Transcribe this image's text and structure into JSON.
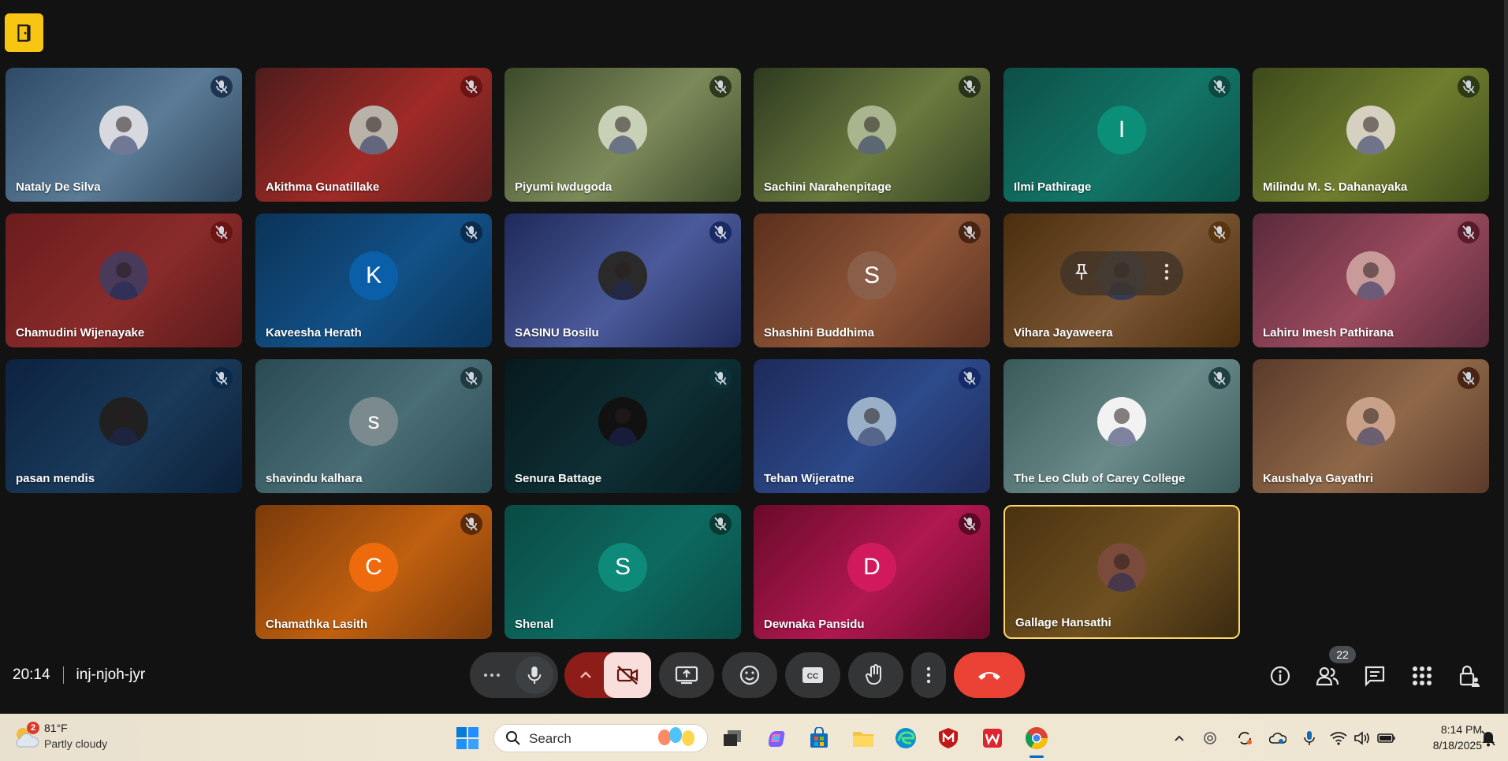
{
  "meeting": {
    "time": "20:14",
    "code": "inj-njoh-jyr",
    "participant_count": "22"
  },
  "colors": {
    "active_border": "#fdd663",
    "end_call": "#ea4335",
    "camera_off": "#f9dedc",
    "logo": "#f9c513"
  },
  "participants": [
    {
      "name": "Nataly De Silva",
      "muted": true,
      "avatar": "photo"
    },
    {
      "name": "Akithma Gunatillake",
      "muted": true,
      "avatar": "photo"
    },
    {
      "name": "Piyumi Iwdugoda",
      "muted": true,
      "avatar": "photo"
    },
    {
      "name": "Sachini Narahenpitage",
      "muted": true,
      "avatar": "photo"
    },
    {
      "name": "Ilmi Pathirage",
      "muted": true,
      "avatar": "letter",
      "letter": "I"
    },
    {
      "name": "Milindu M. S. Dahanayaka",
      "muted": true,
      "avatar": "photo"
    },
    {
      "name": "Chamudini Wijenayake",
      "muted": true,
      "avatar": "photo"
    },
    {
      "name": "Kaveesha Herath",
      "muted": true,
      "avatar": "letter",
      "letter": "K"
    },
    {
      "name": "SASINU Bosilu",
      "muted": true,
      "avatar": "photo"
    },
    {
      "name": "Shashini Buddhima",
      "muted": true,
      "avatar": "letter",
      "letter": "S"
    },
    {
      "name": "Vihara Jayaweera",
      "muted": true,
      "avatar": "photo"
    },
    {
      "name": "Lahiru Imesh Pathirana",
      "muted": true,
      "avatar": "photo"
    },
    {
      "name": "pasan mendis",
      "muted": true,
      "avatar": "photo"
    },
    {
      "name": "shavindu kalhara",
      "muted": true,
      "avatar": "letter",
      "letter": "s"
    },
    {
      "name": "Senura Battage",
      "muted": true,
      "avatar": "photo"
    },
    {
      "name": "Tehan Wijeratne",
      "muted": true,
      "avatar": "photo"
    },
    {
      "name": "The Leo Club of Carey College",
      "muted": true,
      "avatar": "photo"
    },
    {
      "name": "Kaushalya Gayathri",
      "muted": true,
      "avatar": "photo"
    },
    {
      "name": "Chamathka Lasith",
      "muted": true,
      "avatar": "letter",
      "letter": "C"
    },
    {
      "name": "Shenal",
      "muted": true,
      "avatar": "letter",
      "letter": "S"
    },
    {
      "name": "Dewnaka Pansidu",
      "muted": true,
      "avatar": "letter",
      "letter": "D"
    },
    {
      "name": "Gallage Hansathi",
      "muted": false,
      "avatar": "photo",
      "active": true
    }
  ],
  "controls": {
    "more_options_icon": "more-horiz-icon",
    "mic_icon": "microphone-icon",
    "camera_icon": "camera-off-icon",
    "present_icon": "present-screen-icon",
    "reactions_icon": "emoji-icon",
    "captions_icon": "closed-captions-icon",
    "hand_icon": "raise-hand-icon",
    "end_icon": "hang-up-icon"
  },
  "taskbar": {
    "weather_temp": "81°F",
    "weather_desc": "Partly cloudy",
    "weather_badge": "2",
    "search_placeholder": "Search",
    "time": "8:14 PM",
    "date": "8/18/2025"
  }
}
